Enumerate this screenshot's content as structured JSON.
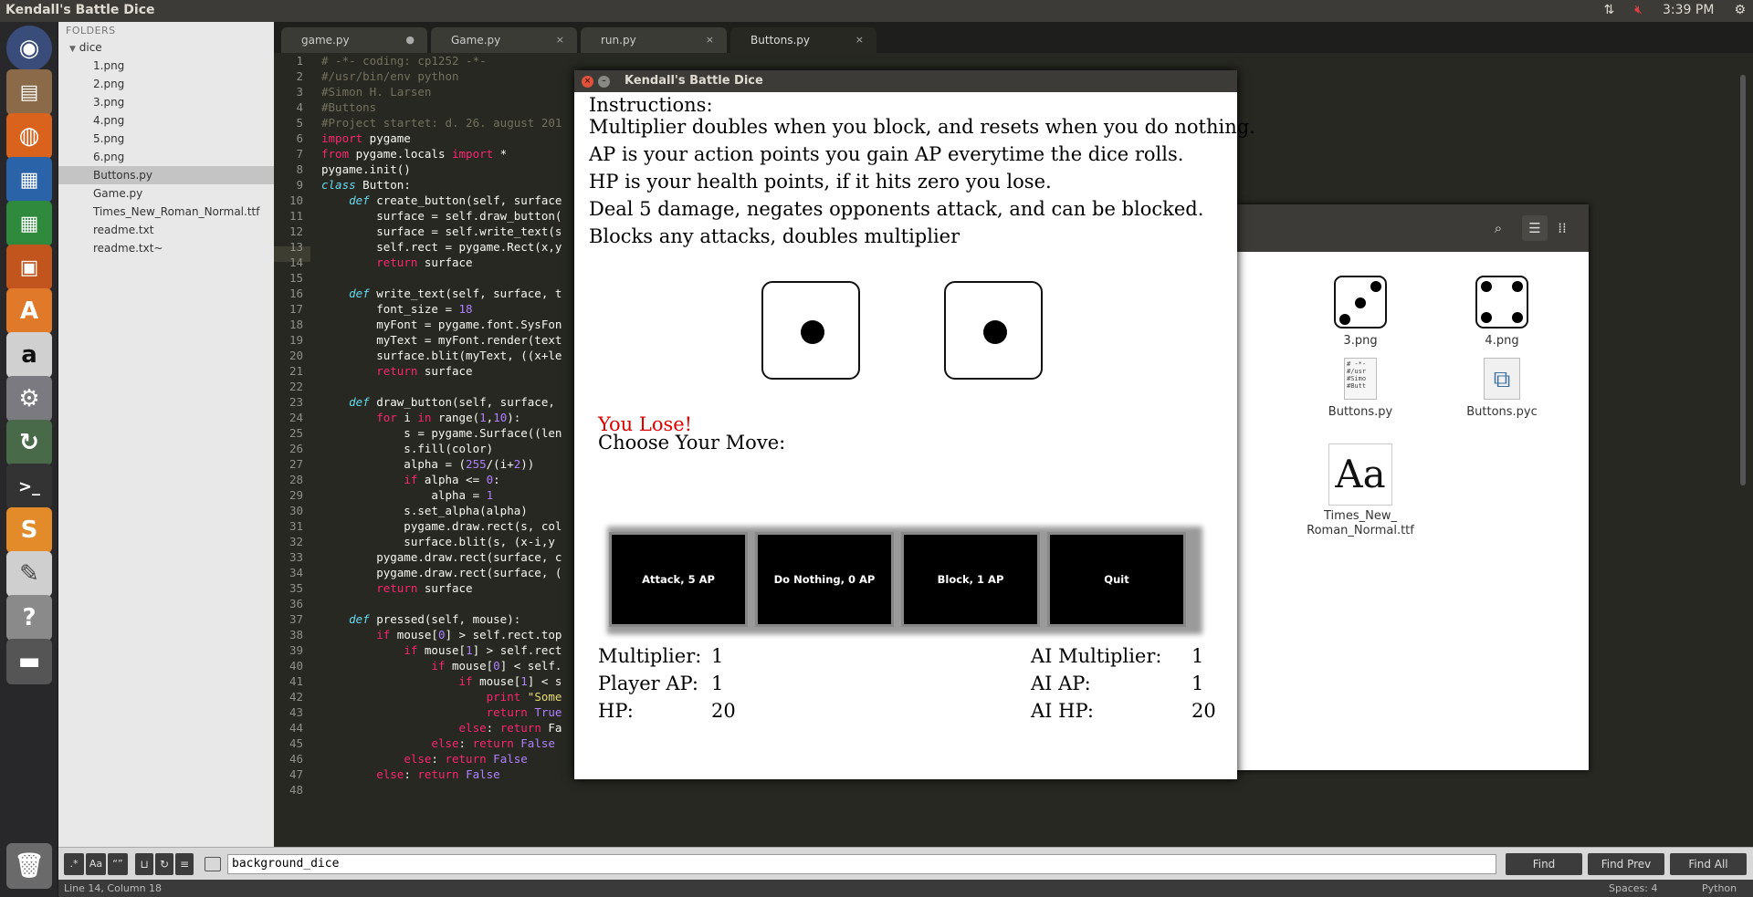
{
  "topbar": {
    "title": "Kendall's Battle Dice",
    "time": "3:39 PM"
  },
  "sidebar": {
    "header": "FOLDERS",
    "folder": "dice",
    "files": [
      "1.png",
      "2.png",
      "3.png",
      "4.png",
      "5.png",
      "6.png",
      "Buttons.py",
      "Game.py",
      "Times_New_Roman_Normal.ttf",
      "readme.txt",
      "readme.txt~"
    ],
    "selected": "Buttons.py"
  },
  "tabs": [
    {
      "label": "game.py",
      "close": "●"
    },
    {
      "label": "Game.py",
      "close": "×"
    },
    {
      "label": "run.py",
      "close": "×"
    },
    {
      "label": "Buttons.py",
      "close": "×"
    }
  ],
  "code": {
    "line_numbers": [
      "1",
      "2",
      "3",
      "4",
      "5",
      "6",
      "7",
      "8",
      "9",
      "10",
      "11",
      "12",
      "13",
      "14",
      "15",
      "16",
      "17",
      "18",
      "19",
      "20",
      "21",
      "22",
      "23",
      "24",
      "25",
      "26",
      "27",
      "28",
      "29",
      "30",
      "31",
      "32",
      "33",
      "34",
      "35",
      "36",
      "37",
      "38",
      "39",
      "40",
      "41",
      "42",
      "43",
      "44",
      "45",
      "46",
      "47",
      "48"
    ],
    "lines": [
      "# -*- coding: cp1252 -*-",
      "#/usr/bin/env python",
      "#Simon H. Larsen",
      "#Buttons",
      "#Project startet: d. 26. august 201",
      "import pygame",
      "from pygame.locals import *",
      "pygame.init()",
      "class Button:",
      "    def create_button(self, surface",
      "        surface = self.draw_button(",
      "        surface = self.write_text(s",
      "        self.rect = pygame.Rect(x,y",
      "        return surface",
      "",
      "    def write_text(self, surface, t",
      "        font_size = 18",
      "        myFont = pygame.font.SysFon",
      "        myText = myFont.render(text",
      "        surface.blit(myText, ((x+le",
      "        return surface",
      "",
      "    def draw_button(self, surface,",
      "        for i in range(1,10):",
      "            s = pygame.Surface((len",
      "            s.fill(color)",
      "            alpha = (255/(i+2))",
      "            if alpha <= 0:",
      "                alpha = 1",
      "            s.set_alpha(alpha)",
      "            pygame.draw.rect(s, col",
      "            surface.blit(s, (x-i,y",
      "        pygame.draw.rect(surface, c",
      "        pygame.draw.rect(surface, (",
      "        return surface",
      "",
      "    def pressed(self, mouse):",
      "        if mouse[0] > self.rect.top",
      "            if mouse[1] > self.rect",
      "                if mouse[0] < self.",
      "                    if mouse[1] < s",
      "                        print \"Some",
      "                        return True",
      "                    else: return Fa",
      "                else: return False",
      "            else: return False",
      "        else: return False",
      ""
    ]
  },
  "find": {
    "value": "background_dice",
    "find": "Find",
    "find_prev": "Find Prev",
    "find_all": "Find All"
  },
  "status": {
    "position": "Line 14, Column 18",
    "spaces": "Spaces: 4",
    "syntax": "Python"
  },
  "filemgr": {
    "files": [
      {
        "name": "3.png"
      },
      {
        "name": "4.png"
      },
      {
        "name": "Buttons.py"
      },
      {
        "name": "Buttons.pyc"
      },
      {
        "name": "Times_New_\nRoman_Normal.ttf"
      }
    ],
    "font_preview": "Aa",
    "text_preview": "# -*-\n#/usr\n#Simo\n#Butt"
  },
  "game": {
    "window_title": "Kendall's Battle Dice",
    "instructions": [
      "Instructions:",
      "Multiplier doubles when you block, and resets when you do nothing.",
      "AP is your action points you gain AP everytime the dice rolls.",
      "HP is your health points, if it hits zero you lose.",
      "Deal 5 damage, negates opponents attack, and can be blocked.",
      "Blocks any attacks, doubles multiplier"
    ],
    "dice": [
      1,
      1
    ],
    "result": "You Lose!",
    "choose": "Choose Your Move:",
    "moves": [
      "Attack, 5 AP",
      "Do Nothing, 0 AP",
      "Block, 1 AP",
      "Quit"
    ],
    "player": {
      "mult_label": "Multiplier:",
      "mult": "1",
      "ap_label": "Player AP:",
      "ap": "1",
      "hp_label": "HP:",
      "hp": "20"
    },
    "ai": {
      "mult_label": "AI Multiplier:",
      "mult": "1",
      "ap_label": "AI AP:",
      "ap": "1",
      "hp_label": "AI HP:",
      "hp": "20"
    }
  }
}
